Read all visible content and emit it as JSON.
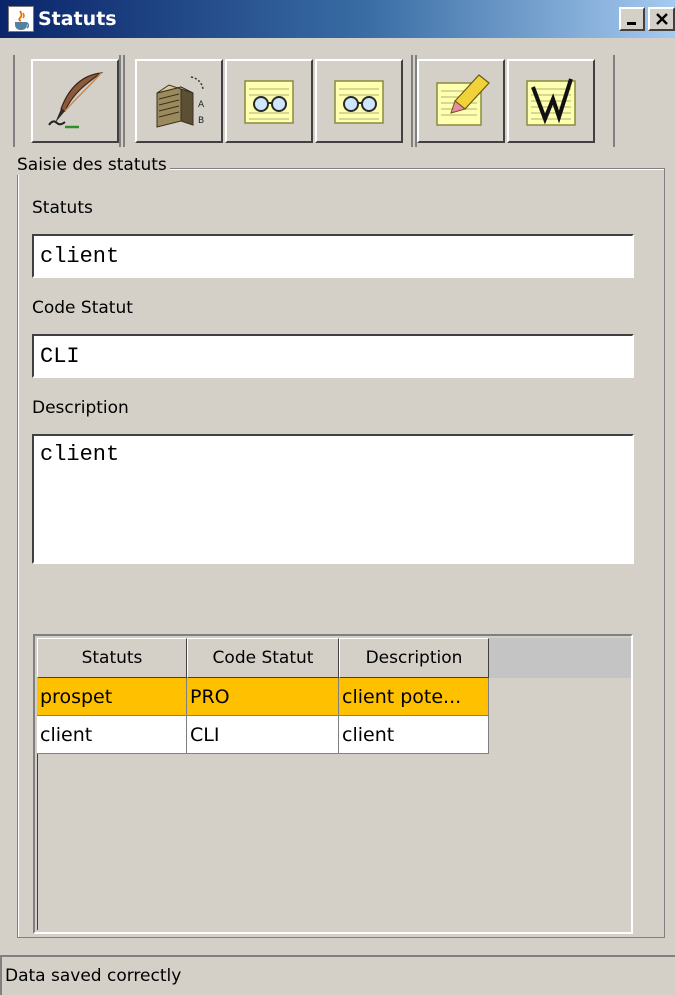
{
  "window": {
    "title": "Statuts",
    "minimize_glyph": "_",
    "close_glyph": "✕"
  },
  "toolbar": {
    "buttons": [
      {
        "icon": "quill-pen-icon"
      },
      {
        "icon": "sort-box-icon"
      },
      {
        "icon": "view-document-icon"
      },
      {
        "icon": "view-document-alt-icon"
      },
      {
        "icon": "edit-document-icon"
      },
      {
        "icon": "delete-document-icon"
      }
    ]
  },
  "form": {
    "group_title": "Saisie des statuts",
    "statuts_label": "Statuts",
    "statuts_value": "client",
    "code_label": "Code Statut",
    "code_value": "CLI",
    "description_label": "Description",
    "description_value": "client"
  },
  "table": {
    "columns": [
      "Statuts",
      "Code Statut",
      "Description"
    ],
    "rows": [
      {
        "statuts": "prospet",
        "code": "PRO",
        "description": "client pote...",
        "selected": true
      },
      {
        "statuts": "client",
        "code": "CLI",
        "description": "client",
        "selected": false
      }
    ]
  },
  "status": {
    "message": "Data saved correctly"
  },
  "colors": {
    "title_gradient_start": "#0a246a",
    "window_bg": "#d4d0c8",
    "selected_row": "#ffc000"
  }
}
